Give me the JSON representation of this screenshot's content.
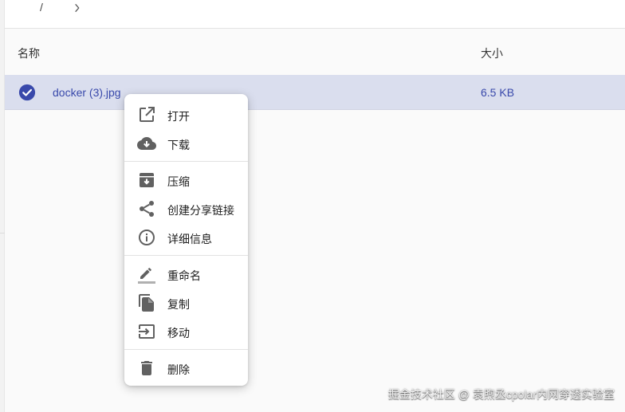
{
  "breadcrumb": {
    "root": "/"
  },
  "table": {
    "headers": {
      "name": "名称",
      "size": "大小"
    },
    "rows": [
      {
        "name": "docker (3).jpg",
        "size": "6.5 KB",
        "selected": true
      }
    ]
  },
  "context_menu": {
    "items": [
      {
        "label": "打开",
        "icon": "open-in-new-icon"
      },
      {
        "label": "下载",
        "icon": "cloud-download-icon"
      },
      {
        "label": "压缩",
        "icon": "archive-icon"
      },
      {
        "label": "创建分享链接",
        "icon": "share-icon"
      },
      {
        "label": "详细信息",
        "icon": "info-icon"
      },
      {
        "label": "重命名",
        "icon": "rename-pencil-icon"
      },
      {
        "label": "复制",
        "icon": "copy-icon"
      },
      {
        "label": "移动",
        "icon": "move-icon"
      },
      {
        "label": "删除",
        "icon": "delete-icon"
      }
    ]
  },
  "watermark": "掘金技术社区 @ 袁煦丞cpolar内网穿透实验室",
  "colors": {
    "accent": "#3949ab",
    "selected_row": "#dadeee",
    "icon": "#616161"
  }
}
